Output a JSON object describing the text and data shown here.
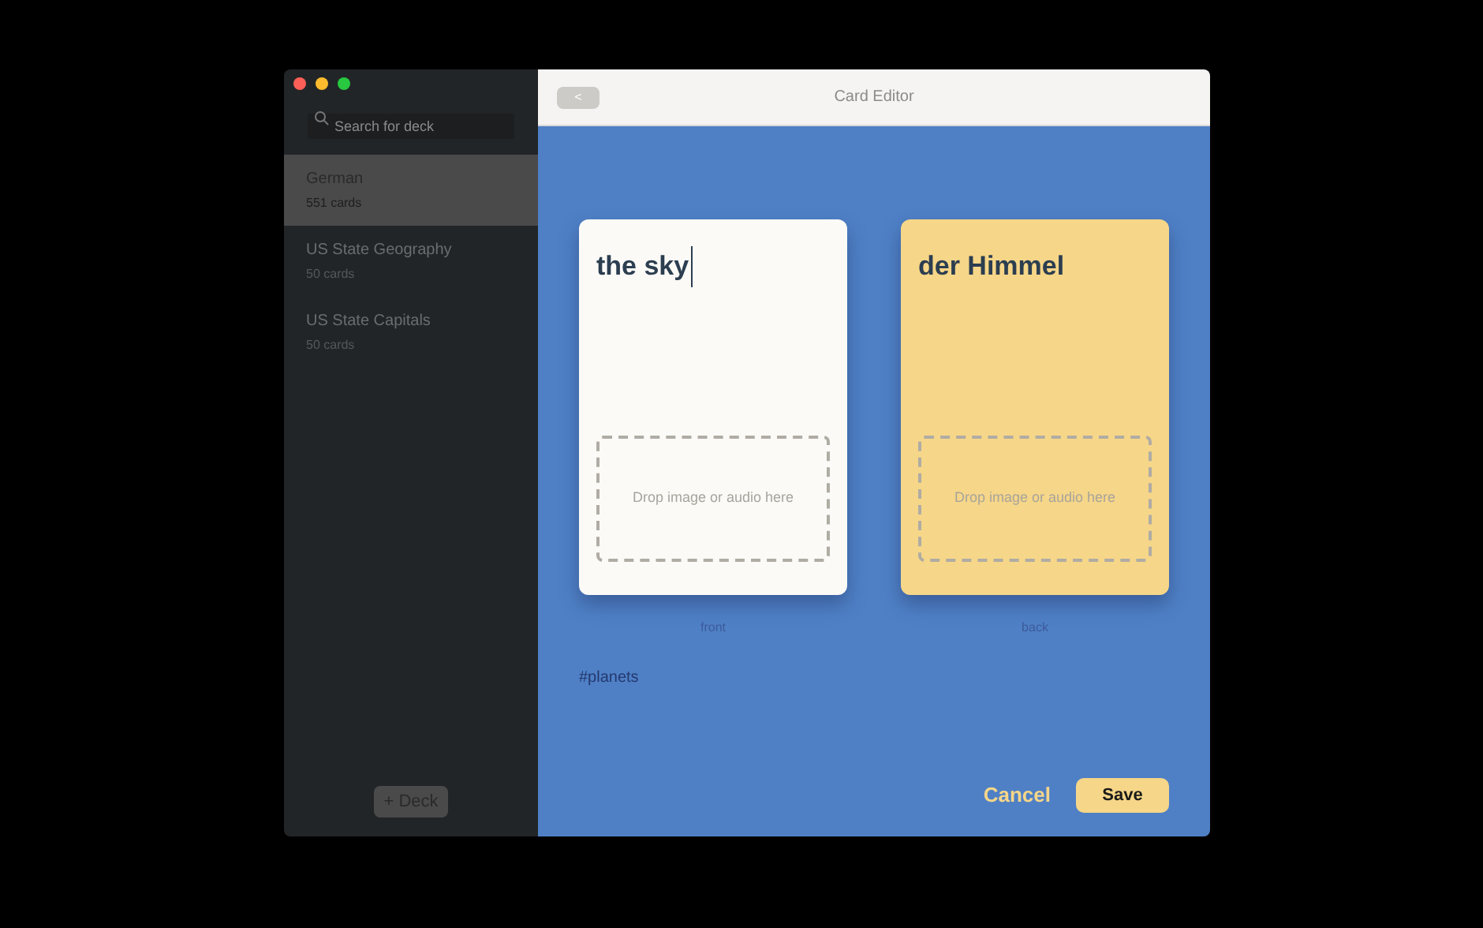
{
  "sidebar": {
    "search": {
      "placeholder": "Search for deck"
    },
    "decks": [
      {
        "name": "German",
        "count": "551 cards",
        "selected": true
      },
      {
        "name": "US State Geography",
        "count": "50 cards",
        "selected": false
      },
      {
        "name": "US State Capitals",
        "count": "50 cards",
        "selected": false
      }
    ],
    "add_button": "+ Deck"
  },
  "header": {
    "back_button": "<",
    "title": "Card Editor"
  },
  "cards": [
    {
      "text": "the sky",
      "focused": true,
      "color": "#fbfaf7",
      "drop_zone": "Drop image or audio here",
      "label": "front"
    },
    {
      "text": "der Himmel",
      "focused": false,
      "color": "#f6d688",
      "drop_zone": "Drop image or audio here",
      "label": "back"
    }
  ],
  "tags": "#planets",
  "buttons": {
    "cancel": "Cancel",
    "save": "Save"
  }
}
